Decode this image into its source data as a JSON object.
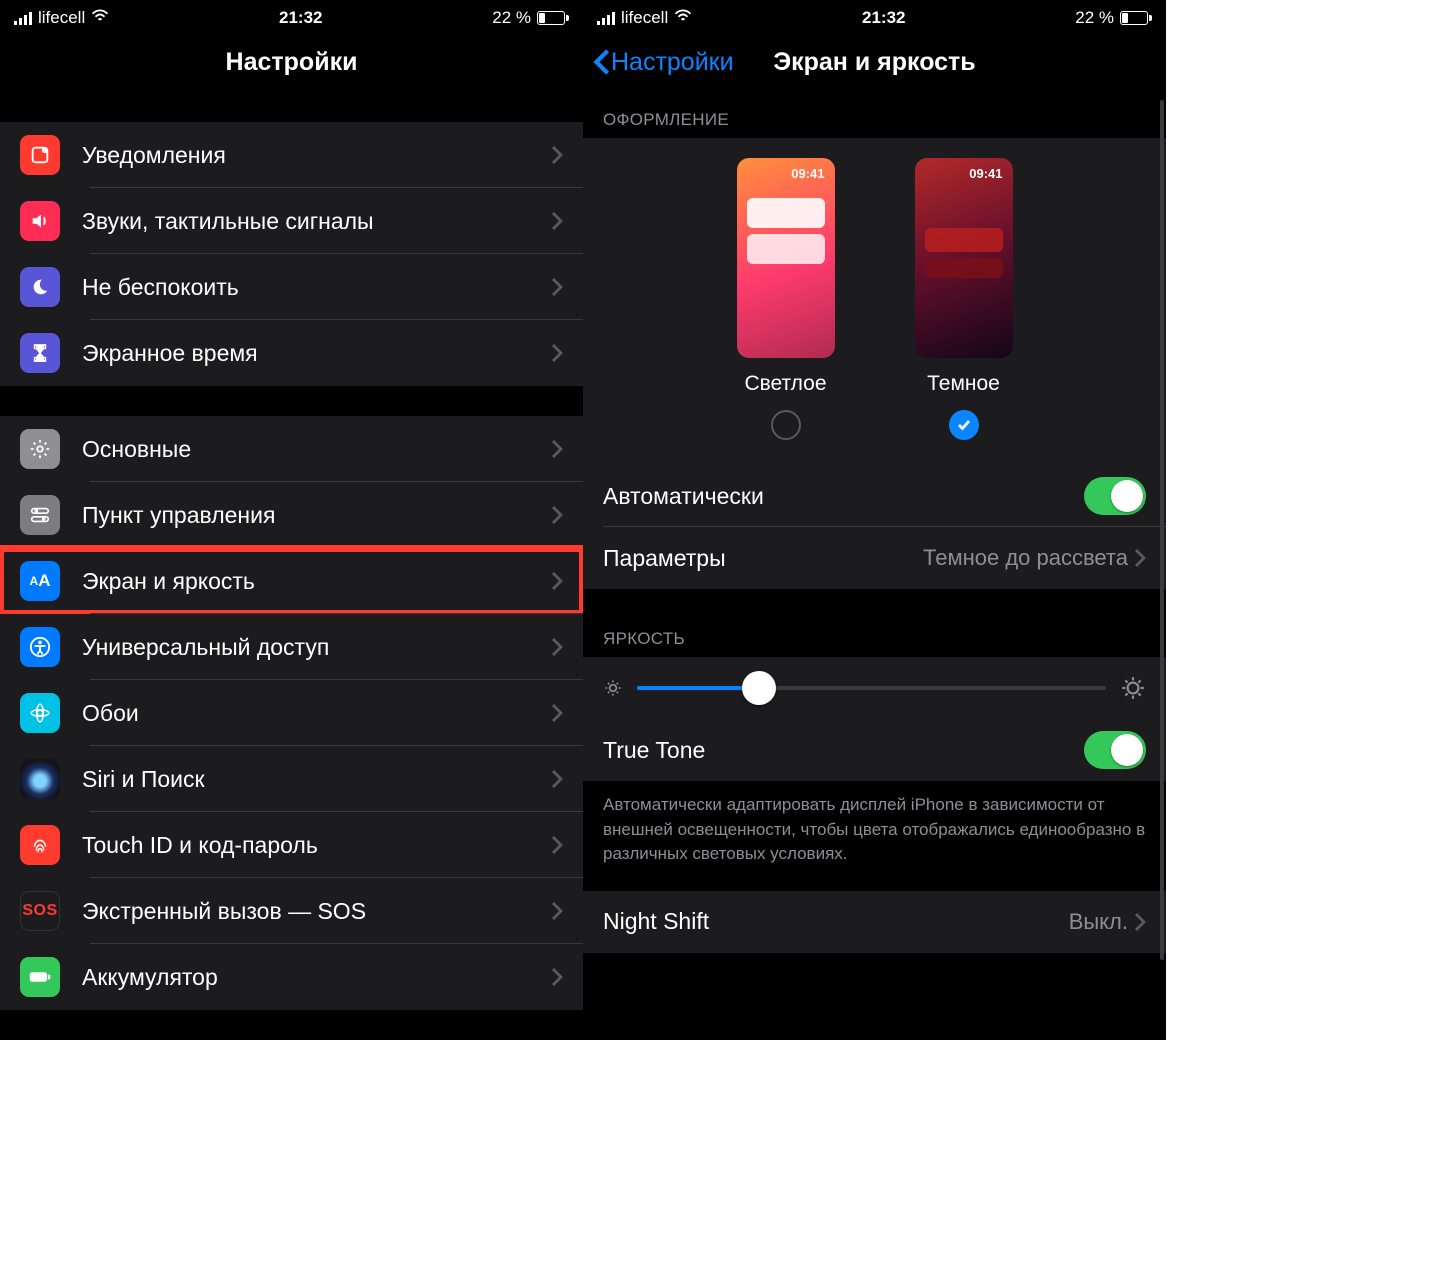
{
  "status": {
    "carrier": "lifecell",
    "time": "21:32",
    "battery_pct": "22 %"
  },
  "left": {
    "title": "Настройки",
    "items": {
      "notifications": "Уведомления",
      "sounds": "Звуки, тактильные сигналы",
      "dnd": "Не беспокоить",
      "screentime": "Экранное время",
      "general": "Основные",
      "control": "Пункт управления",
      "display": "Экран и яркость",
      "accessibility": "Универсальный доступ",
      "wallpaper": "Обои",
      "siri": "Siri и Поиск",
      "touchid": "Touch ID и код-пароль",
      "sos": "Экстренный вызов — SOS",
      "sos_icon": "SOS",
      "battery": "Аккумулятор"
    }
  },
  "right": {
    "back": "Настройки",
    "title": "Экран и яркость",
    "appearance_header": "ОФОРМЛЕНИЕ",
    "preview_time": "09:41",
    "light_label": "Светлое",
    "dark_label": "Темное",
    "auto_label": "Автоматически",
    "options_label": "Параметры",
    "options_value": "Темное до рассвета",
    "brightness_header": "ЯРКОСТЬ",
    "truetone_label": "True Tone",
    "truetone_desc": "Автоматически адаптировать дисплей iPhone в зависимости от внешней освещенности, чтобы цвета отображались единообразно в различных световых условиях.",
    "nightshift_label": "Night Shift",
    "nightshift_value": "Выкл."
  }
}
